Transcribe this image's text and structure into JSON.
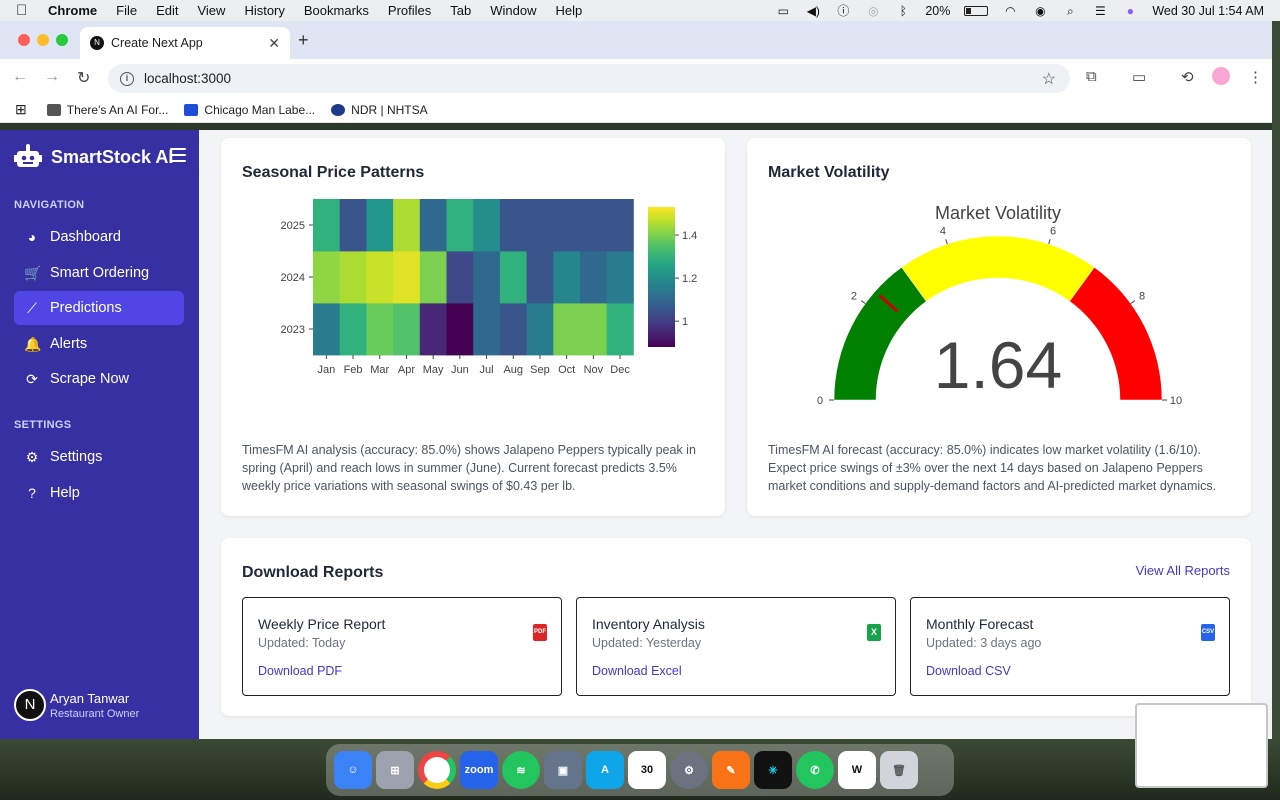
{
  "menubar": {
    "app": "Chrome",
    "items": [
      "File",
      "Edit",
      "View",
      "History",
      "Bookmarks",
      "Profiles",
      "Tab",
      "Window",
      "Help"
    ],
    "battery": "20%",
    "datetime": "Wed 30 Jul  1:54 AM"
  },
  "browser": {
    "tab_title": "Create Next App",
    "url": "localhost:3000",
    "bookmarks": [
      "There's An AI For...",
      "Chicago Man Labe...",
      "NDR | NHTSA"
    ]
  },
  "sidebar": {
    "brand": "SmartStock AI",
    "nav_title": "NAVIGATION",
    "nav_items": [
      {
        "label": "Dashboard",
        "icon": "gauge-icon"
      },
      {
        "label": "Smart Ordering",
        "icon": "cart-icon"
      },
      {
        "label": "Predictions",
        "icon": "chart-line-icon",
        "active": true
      },
      {
        "label": "Alerts",
        "icon": "bell-icon"
      },
      {
        "label": "Scrape Now",
        "icon": "refresh-icon"
      }
    ],
    "settings_title": "SETTINGS",
    "settings_items": [
      {
        "label": "Settings",
        "icon": "gear-icon"
      },
      {
        "label": "Help",
        "icon": "help-icon"
      }
    ],
    "user": {
      "initial": "N",
      "name": "Aryan Tanwar",
      "role": "Restaurant Owner"
    }
  },
  "seasonal": {
    "title": "Seasonal Price Patterns",
    "description": "TimesFM AI analysis (accuracy: 85.0%) shows Jalapeno Peppers typically peak in spring (April) and reach lows in summer (June). Current forecast predicts 3.5% weekly price variations with seasonal swings of $0.43 per lb."
  },
  "volatility": {
    "title": "Market Volatility",
    "description": "TimesFM AI forecast (accuracy: 85.0%) indicates low market volatility (1.6/10). Expect price swings of ±3% over the next 14 days based on Jalapeno Peppers market conditions and supply-demand factors and AI-predicted market dynamics."
  },
  "reports": {
    "title": "Download Reports",
    "view_all": "View All Reports",
    "items": [
      {
        "title": "Weekly Price Report",
        "updated": "Updated: Today",
        "link": "Download PDF",
        "icon": "pdf-icon",
        "icon_label": "PDF",
        "color": "#dc2626"
      },
      {
        "title": "Inventory Analysis",
        "updated": "Updated: Yesterday",
        "link": "Download Excel",
        "icon": "excel-icon",
        "icon_label": "X",
        "color": "#16a34a"
      },
      {
        "title": "Monthly Forecast",
        "updated": "Updated: 3 days ago",
        "link": "Download CSV",
        "icon": "csv-icon",
        "icon_label": "CSV",
        "color": "#2563eb"
      }
    ]
  },
  "chart_data": [
    {
      "type": "heatmap",
      "title": "",
      "x": [
        "Jan",
        "Feb",
        "Mar",
        "Apr",
        "May",
        "Jun",
        "Jul",
        "Aug",
        "Sep",
        "Oct",
        "Nov",
        "Dec"
      ],
      "y": [
        "2023",
        "2024",
        "2025"
      ],
      "z": [
        [
          1.15,
          1.3,
          1.38,
          1.35,
          0.95,
          0.88,
          1.1,
          1.05,
          1.15,
          1.4,
          1.4,
          1.3
        ],
        [
          1.42,
          1.45,
          1.48,
          1.5,
          1.4,
          1.02,
          1.1,
          1.3,
          1.05,
          1.18,
          1.1,
          1.15
        ],
        [
          1.3,
          1.05,
          1.22,
          1.45,
          1.1,
          1.3,
          1.2,
          1.05,
          1.05,
          1.05,
          1.05,
          1.05
        ]
      ],
      "colorbar_ticks": [
        1,
        1.2,
        1.4
      ],
      "zmin": 0.88,
      "zmax": 1.53,
      "colorscale": "viridis"
    },
    {
      "type": "gauge",
      "title": "Market Volatility",
      "value": 1.64,
      "value_label": "1.64",
      "range": [
        0,
        10
      ],
      "ticks": [
        0,
        2,
        4,
        6,
        8,
        10
      ],
      "bands": [
        {
          "from": 0,
          "to": 3,
          "color": "#008000"
        },
        {
          "from": 3,
          "to": 7,
          "color": "#ffff00"
        },
        {
          "from": 7,
          "to": 10,
          "color": "#ff0000"
        }
      ],
      "threshold": 2.3
    }
  ]
}
